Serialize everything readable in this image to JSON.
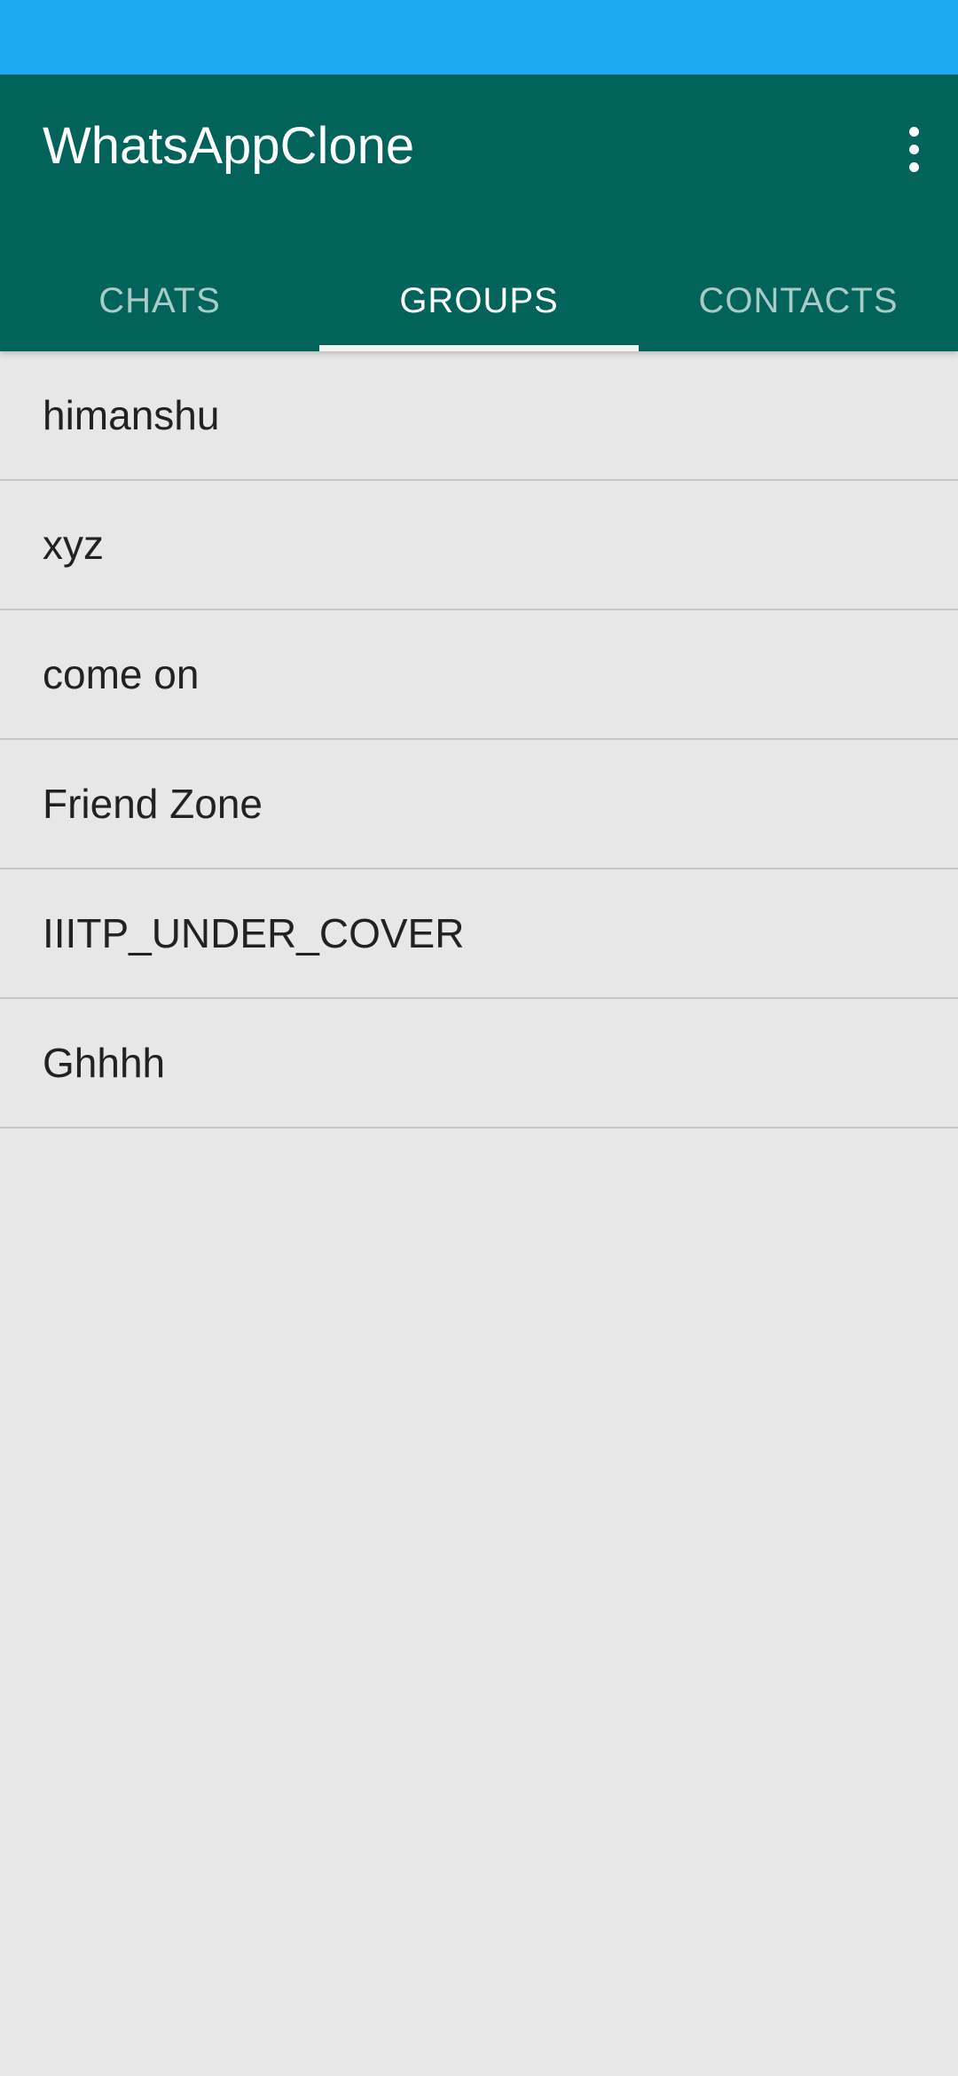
{
  "colors": {
    "status_bar": "#1eaaf1",
    "app_bar": "#02635a",
    "tab_inactive_text": "#a9cbc7",
    "tab_active_text": "#ffffff",
    "background": "#e7e7e7",
    "divider": "#c8c8c8"
  },
  "app_bar": {
    "title": "WhatsAppClone",
    "overflow_icon": "more-vert-icon"
  },
  "tabs": [
    {
      "label": "CHATS",
      "active": false
    },
    {
      "label": "GROUPS",
      "active": true
    },
    {
      "label": "CONTACTS",
      "active": false
    }
  ],
  "groups": [
    "himanshu",
    "xyz",
    "come on",
    "Friend Zone",
    "IIITP_UNDER_COVER",
    "Ghhhh"
  ]
}
